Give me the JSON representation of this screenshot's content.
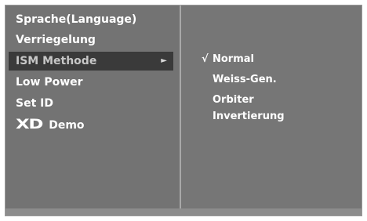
{
  "menu": {
    "items": [
      {
        "label": "Sprache(Language)"
      },
      {
        "label": "Verriegelung"
      },
      {
        "label": "ISM Methode",
        "arrow": "►"
      },
      {
        "label": "Low Power"
      },
      {
        "label": "Set ID"
      },
      {
        "logo_text": "XD",
        "label": "Demo"
      }
    ]
  },
  "submenu": {
    "check_mark": "√",
    "options": [
      {
        "label": "Normal",
        "checked": true
      },
      {
        "label": "Weiss-Gen."
      },
      {
        "label": "Orbiter"
      },
      {
        "label": "Invertierung"
      }
    ]
  },
  "colors": {
    "panel_bg": "#737373",
    "selected_bg": "#3a3a3a",
    "text": "#ffffff"
  }
}
